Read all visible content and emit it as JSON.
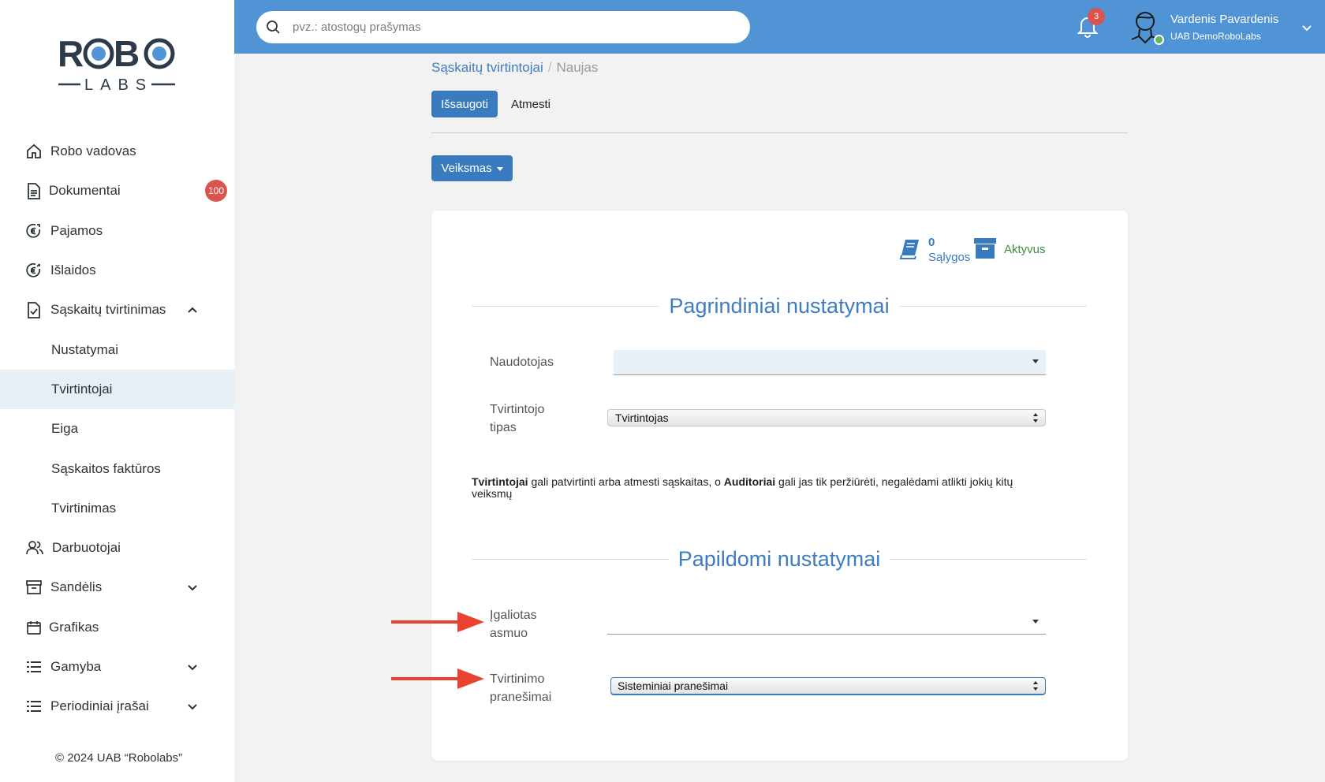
{
  "sidebar": {
    "logo": {
      "top": "ROBO",
      "bottom": "LABS"
    },
    "items": [
      {
        "label": "Robo vadovas",
        "icon": "home-icon"
      },
      {
        "label": "Dokumentai",
        "icon": "document-icon",
        "badge": "100"
      },
      {
        "label": "Pajamos",
        "icon": "euro-in-icon"
      },
      {
        "label": "Išlaidos",
        "icon": "euro-out-icon"
      },
      {
        "label": "Sąskaitų tvirtinimas",
        "icon": "file-check-icon",
        "expanded": true
      },
      {
        "label": "Nustatymai"
      },
      {
        "label": "Tvirtintojai",
        "active": true
      },
      {
        "label": "Eiga"
      },
      {
        "label": "Sąskaitos faktūros"
      },
      {
        "label": "Tvirtinimas"
      },
      {
        "label": "Darbuotojai",
        "icon": "users-icon"
      },
      {
        "label": "Sandėlis",
        "icon": "archive-icon"
      },
      {
        "label": "Grafikas",
        "icon": "calendar-icon"
      },
      {
        "label": "Gamyba",
        "icon": "list-icon"
      },
      {
        "label": "Periodiniai įrašai",
        "icon": "list-icon"
      }
    ],
    "copyright": "© 2024 UAB “Robolabs”"
  },
  "topbar": {
    "search_placeholder": "pvz.: atostogų prašymas",
    "notifications": "3",
    "user_name": "Vardenis Pavardenis",
    "company": "UAB DemoRoboLabs"
  },
  "breadcrumb": {
    "parent": "Sąskaitų tvirtintojai",
    "current": "Naujas"
  },
  "toolbar": {
    "save_label": "Išsaugoti",
    "discard_label": "Atmesti",
    "action_label": "Veiksmas"
  },
  "stats": {
    "conditions_count": "0",
    "conditions_label": "Sąlygos",
    "status": "Aktyvus"
  },
  "section_main": {
    "title": "Pagrindiniai nustatymai",
    "user_label": "Naudotojas",
    "user_value": "",
    "type_label_1": "Tvirtintojo",
    "type_label_2": "tipas",
    "type_value": "Tvirtintojas"
  },
  "note": {
    "strong1": "Tvirtintojai",
    "text1": " gali patvirtinti arba atmesti sąskaitas, o ",
    "strong2": "Auditoriai",
    "text2": " gali jas tik peržiūrėti, negalėdami atlikti jokių kitų veiksmų"
  },
  "section_extra": {
    "title": "Papildomi nustatymai",
    "delegate_label_1": "Įgaliotas",
    "delegate_label_2": "asmuo",
    "delegate_value": "",
    "notify_label_1": "Tvirtinimo",
    "notify_label_2": "pranešimai",
    "notify_value": "Sisteminiai pranešimai"
  },
  "colors": {
    "topbar": "#5094d6",
    "primary_button": "#3a7abf",
    "badge": "#d9534f",
    "active_status": "#3c8d3c",
    "annotation_arrow": "#e8432f"
  }
}
